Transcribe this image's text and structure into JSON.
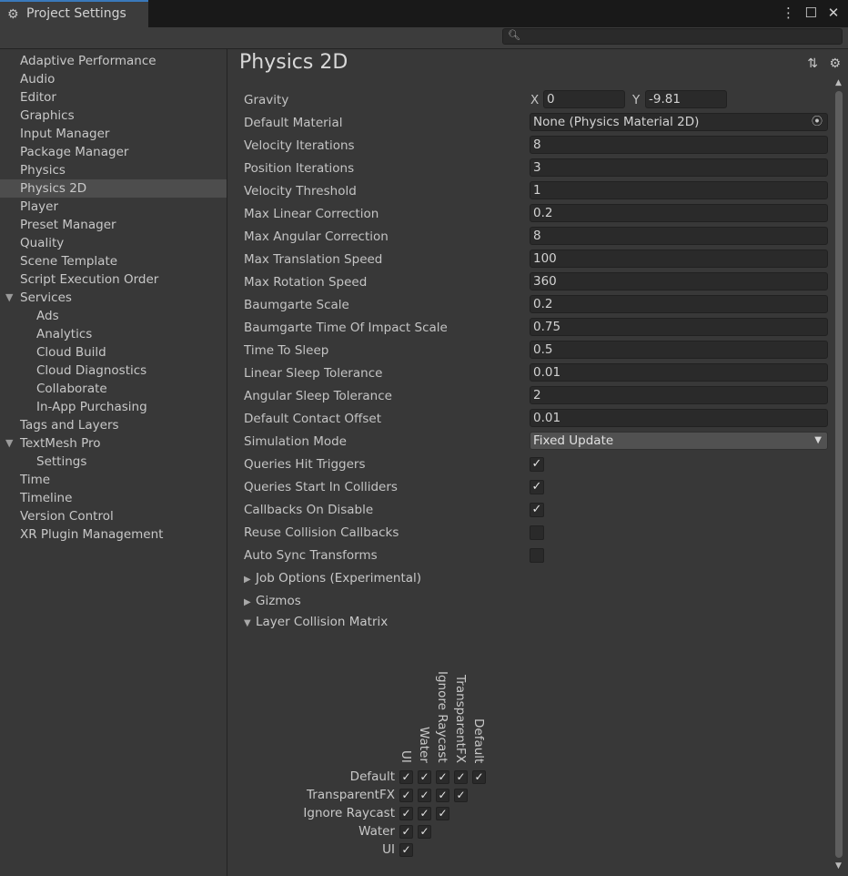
{
  "window": {
    "title": "Project Settings",
    "controls": [
      "⋮",
      "☐",
      "✕"
    ]
  },
  "search": {
    "placeholder": ""
  },
  "sidebar": {
    "items": [
      {
        "label": "Adaptive Performance",
        "level": 0
      },
      {
        "label": "Audio",
        "level": 0
      },
      {
        "label": "Editor",
        "level": 0
      },
      {
        "label": "Graphics",
        "level": 0
      },
      {
        "label": "Input Manager",
        "level": 0
      },
      {
        "label": "Package Manager",
        "level": 0
      },
      {
        "label": "Physics",
        "level": 0
      },
      {
        "label": "Physics 2D",
        "level": 0,
        "selected": true
      },
      {
        "label": "Player",
        "level": 0
      },
      {
        "label": "Preset Manager",
        "level": 0
      },
      {
        "label": "Quality",
        "level": 0
      },
      {
        "label": "Scene Template",
        "level": 0
      },
      {
        "label": "Script Execution Order",
        "level": 0
      },
      {
        "label": "Services",
        "level": 0,
        "expanded": true
      },
      {
        "label": "Ads",
        "level": 1
      },
      {
        "label": "Analytics",
        "level": 1
      },
      {
        "label": "Cloud Build",
        "level": 1
      },
      {
        "label": "Cloud Diagnostics",
        "level": 1
      },
      {
        "label": "Collaborate",
        "level": 1
      },
      {
        "label": "In-App Purchasing",
        "level": 1
      },
      {
        "label": "Tags and Layers",
        "level": 0
      },
      {
        "label": "TextMesh Pro",
        "level": 0,
        "expanded": true
      },
      {
        "label": "Settings",
        "level": 1
      },
      {
        "label": "Time",
        "level": 0
      },
      {
        "label": "Timeline",
        "level": 0
      },
      {
        "label": "Version Control",
        "level": 0
      },
      {
        "label": "XR Plugin Management",
        "level": 0
      }
    ]
  },
  "page": {
    "title": "Physics 2D",
    "gravity": {
      "label": "Gravity",
      "x_label": "X",
      "x": "0",
      "y_label": "Y",
      "y": "-9.81"
    },
    "default_material": {
      "label": "Default Material",
      "value": "None (Physics Material 2D)"
    },
    "fields": [
      {
        "label": "Velocity Iterations",
        "value": "8"
      },
      {
        "label": "Position Iterations",
        "value": "3"
      },
      {
        "label": "Velocity Threshold",
        "value": "1"
      },
      {
        "label": "Max Linear Correction",
        "value": "0.2"
      },
      {
        "label": "Max Angular Correction",
        "value": "8"
      },
      {
        "label": "Max Translation Speed",
        "value": "100"
      },
      {
        "label": "Max Rotation Speed",
        "value": "360"
      },
      {
        "label": "Baumgarte Scale",
        "value": "0.2"
      },
      {
        "label": "Baumgarte Time Of Impact Scale",
        "value": "0.75"
      },
      {
        "label": "Time To Sleep",
        "value": "0.5"
      },
      {
        "label": "Linear Sleep Tolerance",
        "value": "0.01"
      },
      {
        "label": "Angular Sleep Tolerance",
        "value": "2"
      },
      {
        "label": "Default Contact Offset",
        "value": "0.01"
      }
    ],
    "simulation_mode": {
      "label": "Simulation Mode",
      "value": "Fixed Update"
    },
    "toggles": [
      {
        "label": "Queries Hit Triggers",
        "checked": true
      },
      {
        "label": "Queries Start In Colliders",
        "checked": true
      },
      {
        "label": "Callbacks On Disable",
        "checked": true
      },
      {
        "label": "Reuse Collision Callbacks",
        "checked": false
      },
      {
        "label": "Auto Sync Transforms",
        "checked": false
      }
    ],
    "foldouts": [
      {
        "label": "Job Options (Experimental)",
        "expanded": false
      },
      {
        "label": "Gizmos",
        "expanded": false
      },
      {
        "label": "Layer Collision Matrix",
        "expanded": true
      }
    ],
    "matrix": {
      "columns": [
        "UI",
        "Water",
        "Ignore Raycast",
        "TransparentFX",
        "Default"
      ],
      "rows": [
        "Default",
        "TransparentFX",
        "Ignore Raycast",
        "Water",
        "UI"
      ],
      "check_glyph": "✓"
    }
  }
}
